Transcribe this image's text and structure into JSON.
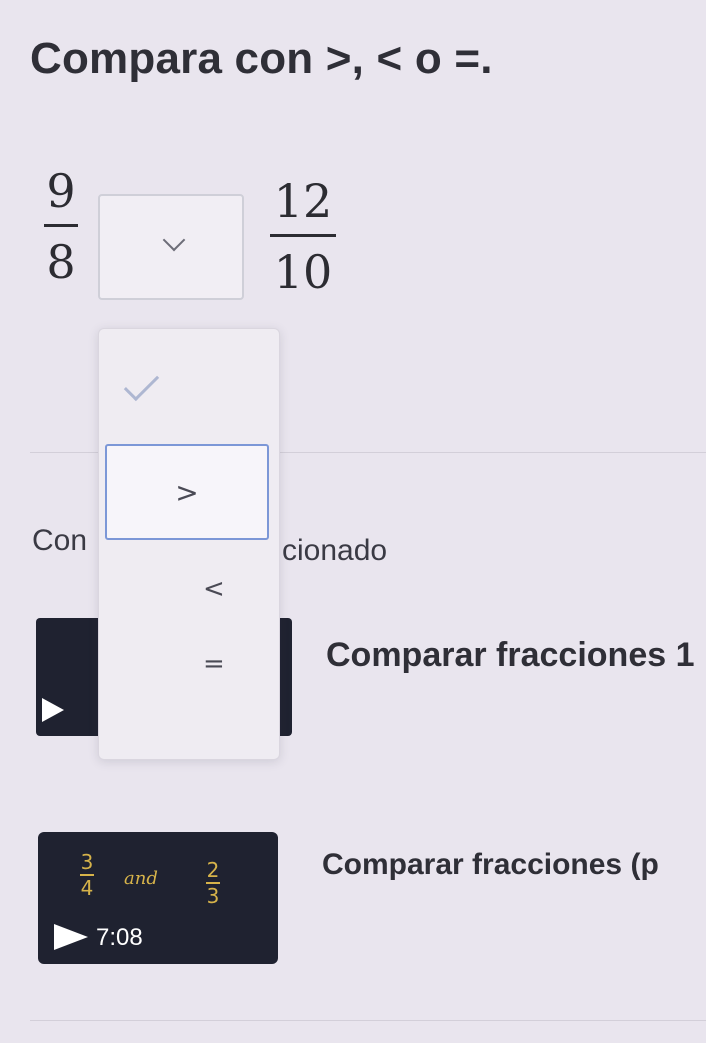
{
  "prompt": {
    "text": "Compara con >, < o =."
  },
  "comparison": {
    "left_fraction": {
      "numerator": "9",
      "denominator": "8"
    },
    "right_fraction": {
      "numerator": "12",
      "denominator": "10"
    },
    "dropdown": {
      "selected": "",
      "options": [
        ">",
        "<",
        "="
      ],
      "highlighted": ">"
    }
  },
  "status": {
    "left": "Con",
    "right": "cionado"
  },
  "videos": [
    {
      "title": "Comparar fracciones 1"
    },
    {
      "title": "Comparar fracciones (p",
      "duration": "7:08",
      "thumb": {
        "frac_a_num": "3",
        "frac_a_den": "4",
        "word": "and",
        "frac_b_num": "2",
        "frac_b_den": "3"
      }
    }
  ],
  "icons": {
    "dropdown_chevron": "chevron-down-icon",
    "menu_check": "check-icon",
    "video_play": "play-icon"
  },
  "colors": {
    "background": "#e9e5ee",
    "focus_border": "#7c97d7",
    "thumbnail_bg": "#1f2230",
    "handwriting": "#d6b34a"
  }
}
